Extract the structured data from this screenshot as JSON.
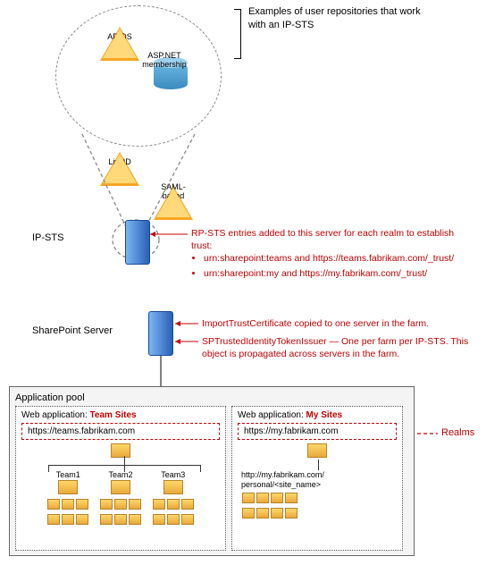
{
  "repositories": {
    "caption": "Examples of user repositories that work with an IP-STS",
    "adds": "AD DS",
    "aspnet": "ASP.NET membership",
    "liveid": "LiveID",
    "saml": "SAML-based"
  },
  "ipsts": {
    "label": "IP-STS",
    "note_title": "RP-STS entries added to this server for each realm to establish trust:",
    "bullets": [
      "urn:sharepoint:teams and https://teams.fabrikam.com/_trust/",
      "urn:sharepoint:my and https://my.fabrikam.com/_trust/"
    ]
  },
  "sharepoint": {
    "label": "SharePoint Server",
    "note1": "ImportTrustCertificate copied to one server in the farm.",
    "note2": "SPTrustedIdentityTokenIssuer — One per farm per IP-STS. This object is propagated across servers in the farm."
  },
  "apppool": {
    "title": "Application pool",
    "teamSites": {
      "header_prefix": "Web application: ",
      "header_name": "Team Sites",
      "url": "https://teams.fabrikam.com",
      "teams": [
        "Team1",
        "Team2",
        "Team3"
      ]
    },
    "mySites": {
      "header_prefix": "Web application: ",
      "header_name": "My Sites",
      "url": "https://my.fabrikam.com",
      "personal": "http://my.fabrikam.com/\npersonal/<site_name>"
    },
    "realms_label": "Realms"
  }
}
